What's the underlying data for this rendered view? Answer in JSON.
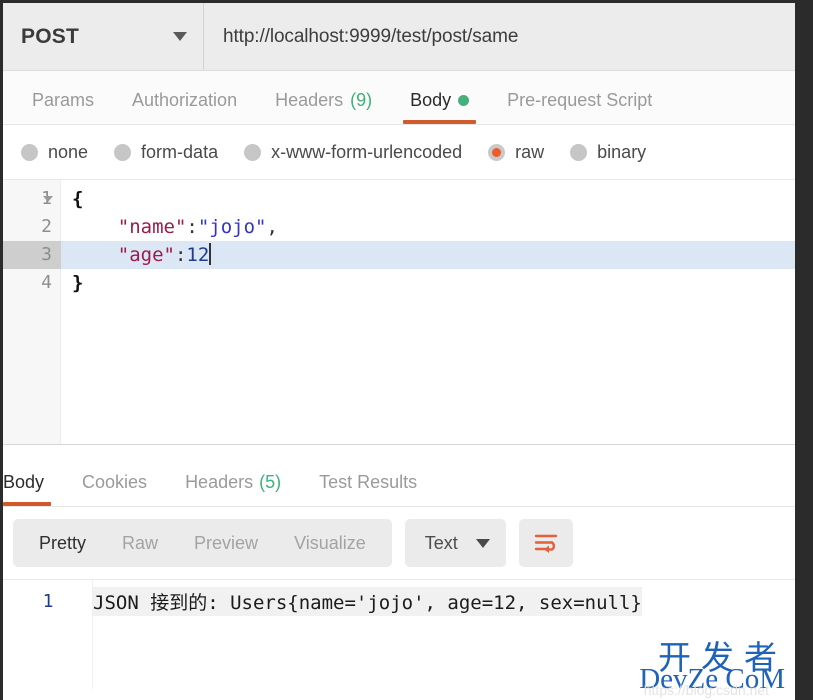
{
  "request": {
    "method": "POST",
    "method_caret": "chevron-down-icon",
    "url": "http://localhost:9999/test/post/same",
    "tabs": [
      {
        "label": "Params",
        "active": false
      },
      {
        "label": "Authorization",
        "active": false
      },
      {
        "label": "Headers",
        "count": "(9)",
        "active": false
      },
      {
        "label": "Body",
        "active": true,
        "dot": true
      },
      {
        "label": "Pre-request Script",
        "active": false
      }
    ],
    "body_types": [
      {
        "label": "none",
        "selected": false
      },
      {
        "label": "form-data",
        "selected": false
      },
      {
        "label": "x-www-form-urlencoded",
        "selected": false
      },
      {
        "label": "raw",
        "selected": true
      },
      {
        "label": "binary",
        "selected": false
      }
    ],
    "editor": {
      "lines": [
        {
          "num": "1",
          "foldable": true,
          "highlight": false,
          "segments": [
            {
              "text": "{",
              "type": "brace"
            }
          ]
        },
        {
          "num": "2",
          "foldable": false,
          "highlight": false,
          "segments": [
            {
              "text": "    ",
              "type": "plain"
            },
            {
              "text": "\"name\"",
              "type": "key"
            },
            {
              "text": ":",
              "type": "punct"
            },
            {
              "text": "\"jojo\"",
              "type": "str"
            },
            {
              "text": ",",
              "type": "punct"
            }
          ]
        },
        {
          "num": "3",
          "foldable": false,
          "highlight": true,
          "caret": true,
          "segments": [
            {
              "text": "    ",
              "type": "plain"
            },
            {
              "text": "\"age\"",
              "type": "key"
            },
            {
              "text": ":",
              "type": "punct"
            },
            {
              "text": "12",
              "type": "num"
            }
          ]
        },
        {
          "num": "4",
          "foldable": false,
          "highlight": false,
          "segments": [
            {
              "text": "}",
              "type": "brace"
            }
          ]
        }
      ]
    }
  },
  "response": {
    "tabs": [
      {
        "label": "Body",
        "active": true
      },
      {
        "label": "Cookies",
        "active": false
      },
      {
        "label": "Headers",
        "count": "(5)",
        "active": false
      },
      {
        "label": "Test Results",
        "active": false
      }
    ],
    "view_modes": [
      {
        "label": "Pretty",
        "active": true
      },
      {
        "label": "Raw",
        "active": false
      },
      {
        "label": "Preview",
        "active": false
      },
      {
        "label": "Visualize",
        "active": false
      }
    ],
    "format_select": {
      "value": "Text",
      "caret": "chevron-down-icon"
    },
    "wrap_button": "word-wrap-icon",
    "body": {
      "line_number": "1",
      "text": "JSON 接到的: Users{name='jojo', age=12, sex=null}"
    }
  },
  "watermark": {
    "cn": "开发者",
    "en": "DevZe CoM",
    "url": "https://blog.csdn.net"
  },
  "colors": {
    "accent_orange": "#cf5c2e",
    "radio_selected": "#ee5b2b",
    "status_green": "#44b17c",
    "count_green": "#3db27a",
    "highlight_line": "#dce7f5",
    "json_key": "#9b1b4a",
    "json_string": "#3434c9",
    "json_number": "#1f3d8f",
    "watermark_blue": "#1f62b8"
  }
}
